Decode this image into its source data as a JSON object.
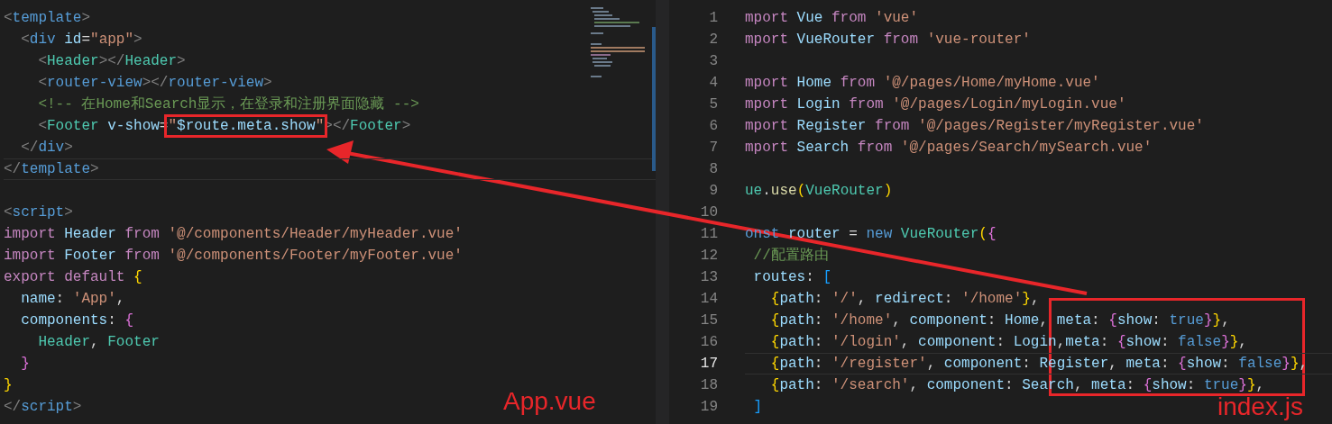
{
  "left_editor": {
    "lines": [
      {
        "current": false,
        "tokens": [
          {
            "text": "<",
            "kind": "punct"
          },
          {
            "text": "template",
            "kind": "tag"
          },
          {
            "text": ">",
            "kind": "punct"
          }
        ]
      },
      {
        "current": false,
        "tokens": [
          {
            "text": "  <",
            "kind": "punct"
          },
          {
            "text": "div",
            "kind": "tag"
          },
          {
            "text": " id",
            "kind": "attr"
          },
          {
            "text": "=",
            "kind": "plain"
          },
          {
            "text": "\"app\"",
            "kind": "string"
          },
          {
            "text": ">",
            "kind": "punct"
          }
        ]
      },
      {
        "current": false,
        "tokens": [
          {
            "text": "    <",
            "kind": "punct"
          },
          {
            "text": "Header",
            "kind": "component"
          },
          {
            "text": "></",
            "kind": "punct"
          },
          {
            "text": "Header",
            "kind": "component"
          },
          {
            "text": ">",
            "kind": "punct"
          }
        ]
      },
      {
        "current": false,
        "tokens": [
          {
            "text": "    <",
            "kind": "punct"
          },
          {
            "text": "router-view",
            "kind": "tag"
          },
          {
            "text": "></",
            "kind": "punct"
          },
          {
            "text": "router-view",
            "kind": "tag"
          },
          {
            "text": ">",
            "kind": "punct"
          }
        ]
      },
      {
        "current": false,
        "tokens": [
          {
            "text": "    <!-- 在Home和Search显示，在登录和注册界面隐藏 -->",
            "kind": "comment"
          }
        ]
      },
      {
        "current": false,
        "tokens": [
          {
            "text": "    <",
            "kind": "punct"
          },
          {
            "text": "Footer",
            "kind": "component"
          },
          {
            "text": " v-show",
            "kind": "attr"
          },
          {
            "text": "=",
            "kind": "plain"
          },
          {
            "text": "\"",
            "kind": "string",
            "framed": true
          },
          {
            "text": "$route.meta.show",
            "kind": "attr",
            "framed": true
          },
          {
            "text": "\"",
            "kind": "string",
            "framed": true
          },
          {
            "text": "></",
            "kind": "punct"
          },
          {
            "text": "Footer",
            "kind": "component"
          },
          {
            "text": ">",
            "kind": "punct"
          }
        ]
      },
      {
        "current": false,
        "tokens": [
          {
            "text": "  </",
            "kind": "punct"
          },
          {
            "text": "div",
            "kind": "tag"
          },
          {
            "text": ">",
            "kind": "punct"
          }
        ]
      },
      {
        "current": true,
        "tokens": [
          {
            "text": "</",
            "kind": "punct"
          },
          {
            "text": "template",
            "kind": "tag"
          },
          {
            "text": ">",
            "kind": "punct"
          }
        ]
      },
      {
        "current": false
      },
      {
        "current": false,
        "tokens": [
          {
            "text": "<",
            "kind": "punct"
          },
          {
            "text": "script",
            "kind": "tag"
          },
          {
            "text": ">",
            "kind": "punct"
          }
        ]
      },
      {
        "current": false,
        "tokens": [
          {
            "text": "import ",
            "kind": "keyword"
          },
          {
            "text": "Header ",
            "kind": "ident"
          },
          {
            "text": "from ",
            "kind": "keyword"
          },
          {
            "text": "'@/components/Header/myHeader.vue'",
            "kind": "string"
          }
        ]
      },
      {
        "current": false,
        "tokens": [
          {
            "text": "import ",
            "kind": "keyword"
          },
          {
            "text": "Footer ",
            "kind": "ident"
          },
          {
            "text": "from ",
            "kind": "keyword"
          },
          {
            "text": "'@/components/Footer/myFooter.vue'",
            "kind": "string"
          }
        ]
      },
      {
        "current": false,
        "tokens": [
          {
            "text": "export default ",
            "kind": "keyword"
          },
          {
            "text": "{",
            "kind": "bracket1"
          }
        ]
      },
      {
        "current": false,
        "tokens": [
          {
            "text": "  name",
            "kind": "ident"
          },
          {
            "text": ": ",
            "kind": "plain"
          },
          {
            "text": "'App'",
            "kind": "string"
          },
          {
            "text": ",",
            "kind": "plain"
          }
        ]
      },
      {
        "current": false,
        "tokens": [
          {
            "text": "  components",
            "kind": "ident"
          },
          {
            "text": ": ",
            "kind": "plain"
          },
          {
            "text": "{",
            "kind": "bracket2"
          }
        ]
      },
      {
        "current": false,
        "tokens": [
          {
            "text": "    Header",
            "kind": "component"
          },
          {
            "text": ", ",
            "kind": "plain"
          },
          {
            "text": "Footer",
            "kind": "component"
          }
        ]
      },
      {
        "current": false,
        "tokens": [
          {
            "text": "  }",
            "kind": "bracket2"
          }
        ]
      },
      {
        "current": false,
        "tokens": [
          {
            "text": "}",
            "kind": "bracket1"
          }
        ]
      },
      {
        "current": false,
        "tokens": [
          {
            "text": "</",
            "kind": "punct"
          },
          {
            "text": "script",
            "kind": "tag"
          },
          {
            "text": ">",
            "kind": "punct"
          }
        ]
      }
    ]
  },
  "right_editor": {
    "lines": [
      {
        "number": "1",
        "current": false,
        "tokens": [
          {
            "text": "mport ",
            "kind": "keyword"
          },
          {
            "text": "Vue ",
            "kind": "ident"
          },
          {
            "text": "from ",
            "kind": "keyword"
          },
          {
            "text": "'vue'",
            "kind": "string"
          }
        ]
      },
      {
        "number": "2",
        "current": false,
        "tokens": [
          {
            "text": "mport ",
            "kind": "keyword"
          },
          {
            "text": "VueRouter ",
            "kind": "ident"
          },
          {
            "text": "from ",
            "kind": "keyword"
          },
          {
            "text": "'vue-router'",
            "kind": "string"
          }
        ]
      },
      {
        "number": "3",
        "current": false
      },
      {
        "number": "4",
        "current": false,
        "tokens": [
          {
            "text": "mport ",
            "kind": "keyword"
          },
          {
            "text": "Home ",
            "kind": "ident"
          },
          {
            "text": "from ",
            "kind": "keyword"
          },
          {
            "text": "'@/pages/Home/myHome.vue'",
            "kind": "string"
          }
        ]
      },
      {
        "number": "5",
        "current": false,
        "tokens": [
          {
            "text": "mport ",
            "kind": "keyword"
          },
          {
            "text": "Login ",
            "kind": "ident"
          },
          {
            "text": "from ",
            "kind": "keyword"
          },
          {
            "text": "'@/pages/Login/myLogin.vue'",
            "kind": "string"
          }
        ]
      },
      {
        "number": "6",
        "current": false,
        "tokens": [
          {
            "text": "mport ",
            "kind": "keyword"
          },
          {
            "text": "Register ",
            "kind": "ident"
          },
          {
            "text": "from ",
            "kind": "keyword"
          },
          {
            "text": "'@/pages/Register/myRegister.vue'",
            "kind": "string"
          }
        ]
      },
      {
        "number": "7",
        "current": false,
        "tokens": [
          {
            "text": "mport ",
            "kind": "keyword"
          },
          {
            "text": "Search ",
            "kind": "ident"
          },
          {
            "text": "from ",
            "kind": "keyword"
          },
          {
            "text": "'@/pages/Search/mySearch.vue'",
            "kind": "string"
          }
        ]
      },
      {
        "number": "8",
        "current": false
      },
      {
        "number": "9",
        "current": false,
        "tokens": [
          {
            "text": "ue",
            "kind": "component"
          },
          {
            "text": ".",
            "kind": "plain"
          },
          {
            "text": "use",
            "kind": "function"
          },
          {
            "text": "(",
            "kind": "bracket1"
          },
          {
            "text": "VueRouter",
            "kind": "component"
          },
          {
            "text": ")",
            "kind": "bracket1"
          }
        ]
      },
      {
        "number": "10",
        "current": false
      },
      {
        "number": "11",
        "current": false,
        "tokens": [
          {
            "text": "onst ",
            "kind": "storage"
          },
          {
            "text": "router",
            "kind": "ident"
          },
          {
            "text": " = ",
            "kind": "plain"
          },
          {
            "text": "new ",
            "kind": "storage"
          },
          {
            "text": "VueRouter",
            "kind": "component"
          },
          {
            "text": "(",
            "kind": "bracket1"
          },
          {
            "text": "{",
            "kind": "bracket2"
          }
        ]
      },
      {
        "number": "12",
        "current": false,
        "tokens": [
          {
            "text": " //配置路由",
            "kind": "comment"
          }
        ]
      },
      {
        "number": "13",
        "current": false,
        "tokens": [
          {
            "text": " routes",
            "kind": "ident"
          },
          {
            "text": ": ",
            "kind": "plain"
          },
          {
            "text": "[",
            "kind": "bracket3"
          }
        ]
      },
      {
        "number": "14",
        "current": false,
        "tokens": [
          {
            "text": "   {",
            "kind": "bracket1"
          },
          {
            "text": "path",
            "kind": "ident"
          },
          {
            "text": ": ",
            "kind": "plain"
          },
          {
            "text": "'/'",
            "kind": "string"
          },
          {
            "text": ", ",
            "kind": "plain"
          },
          {
            "text": "redirect",
            "kind": "ident"
          },
          {
            "text": ": ",
            "kind": "plain"
          },
          {
            "text": "'/home'",
            "kind": "string"
          },
          {
            "text": "}",
            "kind": "bracket1"
          },
          {
            "text": ",",
            "kind": "plain"
          }
        ]
      },
      {
        "number": "15",
        "current": false,
        "tokens": [
          {
            "text": "   {",
            "kind": "bracket1"
          },
          {
            "text": "path",
            "kind": "ident"
          },
          {
            "text": ": ",
            "kind": "plain"
          },
          {
            "text": "'/home'",
            "kind": "string"
          },
          {
            "text": ", ",
            "kind": "plain"
          },
          {
            "text": "component",
            "kind": "ident"
          },
          {
            "text": ": ",
            "kind": "plain"
          },
          {
            "text": "Home",
            "kind": "ident"
          },
          {
            "text": ", ",
            "kind": "plain"
          },
          {
            "text": "meta",
            "kind": "ident"
          },
          {
            "text": ": ",
            "kind": "plain"
          },
          {
            "text": "{",
            "kind": "bracket2"
          },
          {
            "text": "show",
            "kind": "ident"
          },
          {
            "text": ": ",
            "kind": "plain"
          },
          {
            "text": "true",
            "kind": "storage"
          },
          {
            "text": "}",
            "kind": "bracket2"
          },
          {
            "text": "}",
            "kind": "bracket1"
          },
          {
            "text": ",",
            "kind": "plain"
          }
        ]
      },
      {
        "number": "16",
        "current": false,
        "tokens": [
          {
            "text": "   {",
            "kind": "bracket1"
          },
          {
            "text": "path",
            "kind": "ident"
          },
          {
            "text": ": ",
            "kind": "plain"
          },
          {
            "text": "'/login'",
            "kind": "string"
          },
          {
            "text": ", ",
            "kind": "plain"
          },
          {
            "text": "component",
            "kind": "ident"
          },
          {
            "text": ": ",
            "kind": "plain"
          },
          {
            "text": "Login",
            "kind": "ident"
          },
          {
            "text": ",",
            "kind": "plain"
          },
          {
            "text": "meta",
            "kind": "ident"
          },
          {
            "text": ": ",
            "kind": "plain"
          },
          {
            "text": "{",
            "kind": "bracket2"
          },
          {
            "text": "show",
            "kind": "ident"
          },
          {
            "text": ": ",
            "kind": "plain"
          },
          {
            "text": "false",
            "kind": "storage"
          },
          {
            "text": "}",
            "kind": "bracket2"
          },
          {
            "text": "}",
            "kind": "bracket1"
          },
          {
            "text": ",",
            "kind": "plain"
          }
        ]
      },
      {
        "number": "17",
        "current": true,
        "tokens": [
          {
            "text": "   {",
            "kind": "bracket1"
          },
          {
            "text": "path",
            "kind": "ident"
          },
          {
            "text": ": ",
            "kind": "plain"
          },
          {
            "text": "'/register'",
            "kind": "string"
          },
          {
            "text": ", ",
            "kind": "plain"
          },
          {
            "text": "component",
            "kind": "ident"
          },
          {
            "text": ": ",
            "kind": "plain"
          },
          {
            "text": "Register",
            "kind": "ident"
          },
          {
            "text": ", ",
            "kind": "plain"
          },
          {
            "text": "meta",
            "kind": "ident"
          },
          {
            "text": ": ",
            "kind": "plain"
          },
          {
            "text": "{",
            "kind": "bracket2"
          },
          {
            "text": "show",
            "kind": "ident"
          },
          {
            "text": ": ",
            "kind": "plain"
          },
          {
            "text": "false",
            "kind": "storage"
          },
          {
            "text": "}",
            "kind": "bracket2"
          },
          {
            "text": "}",
            "kind": "bracket1"
          },
          {
            "text": ",",
            "kind": "plain"
          }
        ]
      },
      {
        "number": "18",
        "current": false,
        "tokens": [
          {
            "text": "   {",
            "kind": "bracket1"
          },
          {
            "text": "path",
            "kind": "ident"
          },
          {
            "text": ": ",
            "kind": "plain"
          },
          {
            "text": "'/search'",
            "kind": "string"
          },
          {
            "text": ", ",
            "kind": "plain"
          },
          {
            "text": "component",
            "kind": "ident"
          },
          {
            "text": ": ",
            "kind": "plain"
          },
          {
            "text": "Search",
            "kind": "ident"
          },
          {
            "text": ", ",
            "kind": "plain"
          },
          {
            "text": "meta",
            "kind": "ident"
          },
          {
            "text": ": ",
            "kind": "plain"
          },
          {
            "text": "{",
            "kind": "bracket2"
          },
          {
            "text": "show",
            "kind": "ident"
          },
          {
            "text": ": ",
            "kind": "plain"
          },
          {
            "text": "true",
            "kind": "storage"
          },
          {
            "text": "}",
            "kind": "bracket2"
          },
          {
            "text": "}",
            "kind": "bracket1"
          },
          {
            "text": ",",
            "kind": "plain"
          }
        ]
      },
      {
        "number": "19",
        "current": false,
        "tokens": [
          {
            "text": " ]",
            "kind": "bracket3"
          }
        ]
      }
    ]
  },
  "annotations": {
    "left_label": "App.vue",
    "right_label": "index.js"
  }
}
